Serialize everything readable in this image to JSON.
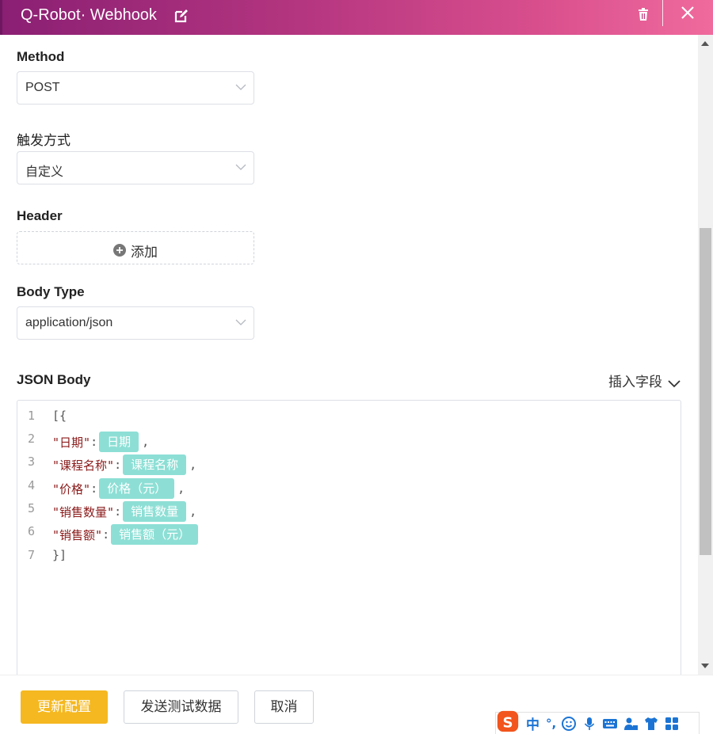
{
  "header": {
    "title": "Q-Robot· Webhook",
    "accent_color": "#b2347f"
  },
  "form": {
    "method": {
      "label": "Method",
      "value": "POST"
    },
    "trigger": {
      "label": "触发方式",
      "value": "自定义"
    },
    "header_field": {
      "label": "Header",
      "add_label": "添加"
    },
    "body_type": {
      "label": "Body Type",
      "value": "application/json"
    },
    "json_body": {
      "label": "JSON Body",
      "insert_field_label": "插入字段"
    }
  },
  "editor": {
    "lines": [
      {
        "num": "1",
        "text": "[{"
      },
      {
        "num": "2",
        "key": "\"日期\"",
        "sep": ":",
        "chip": "日期",
        "tail": ","
      },
      {
        "num": "3",
        "key": "\"课程名称\"",
        "sep": ":",
        "chip": "课程名称",
        "tail": ","
      },
      {
        "num": "4",
        "key": "\"价格\"",
        "sep": ":",
        "chip": "价格（元）",
        "tail": ","
      },
      {
        "num": "5",
        "key": "\"销售数量\"",
        "sep": ":",
        "chip": "销售数量",
        "tail": ","
      },
      {
        "num": "6",
        "key": "\"销售额\"",
        "sep": ":",
        "chip": "销售额（元）",
        "tail": ""
      },
      {
        "num": "7",
        "text": "}]"
      }
    ]
  },
  "footer": {
    "update_label": "更新配置",
    "test_label": "发送测试数据",
    "cancel_label": "取消",
    "primary_color": "#f5b820"
  },
  "ime": {
    "mode_label": "中",
    "punct_label": "°,"
  }
}
